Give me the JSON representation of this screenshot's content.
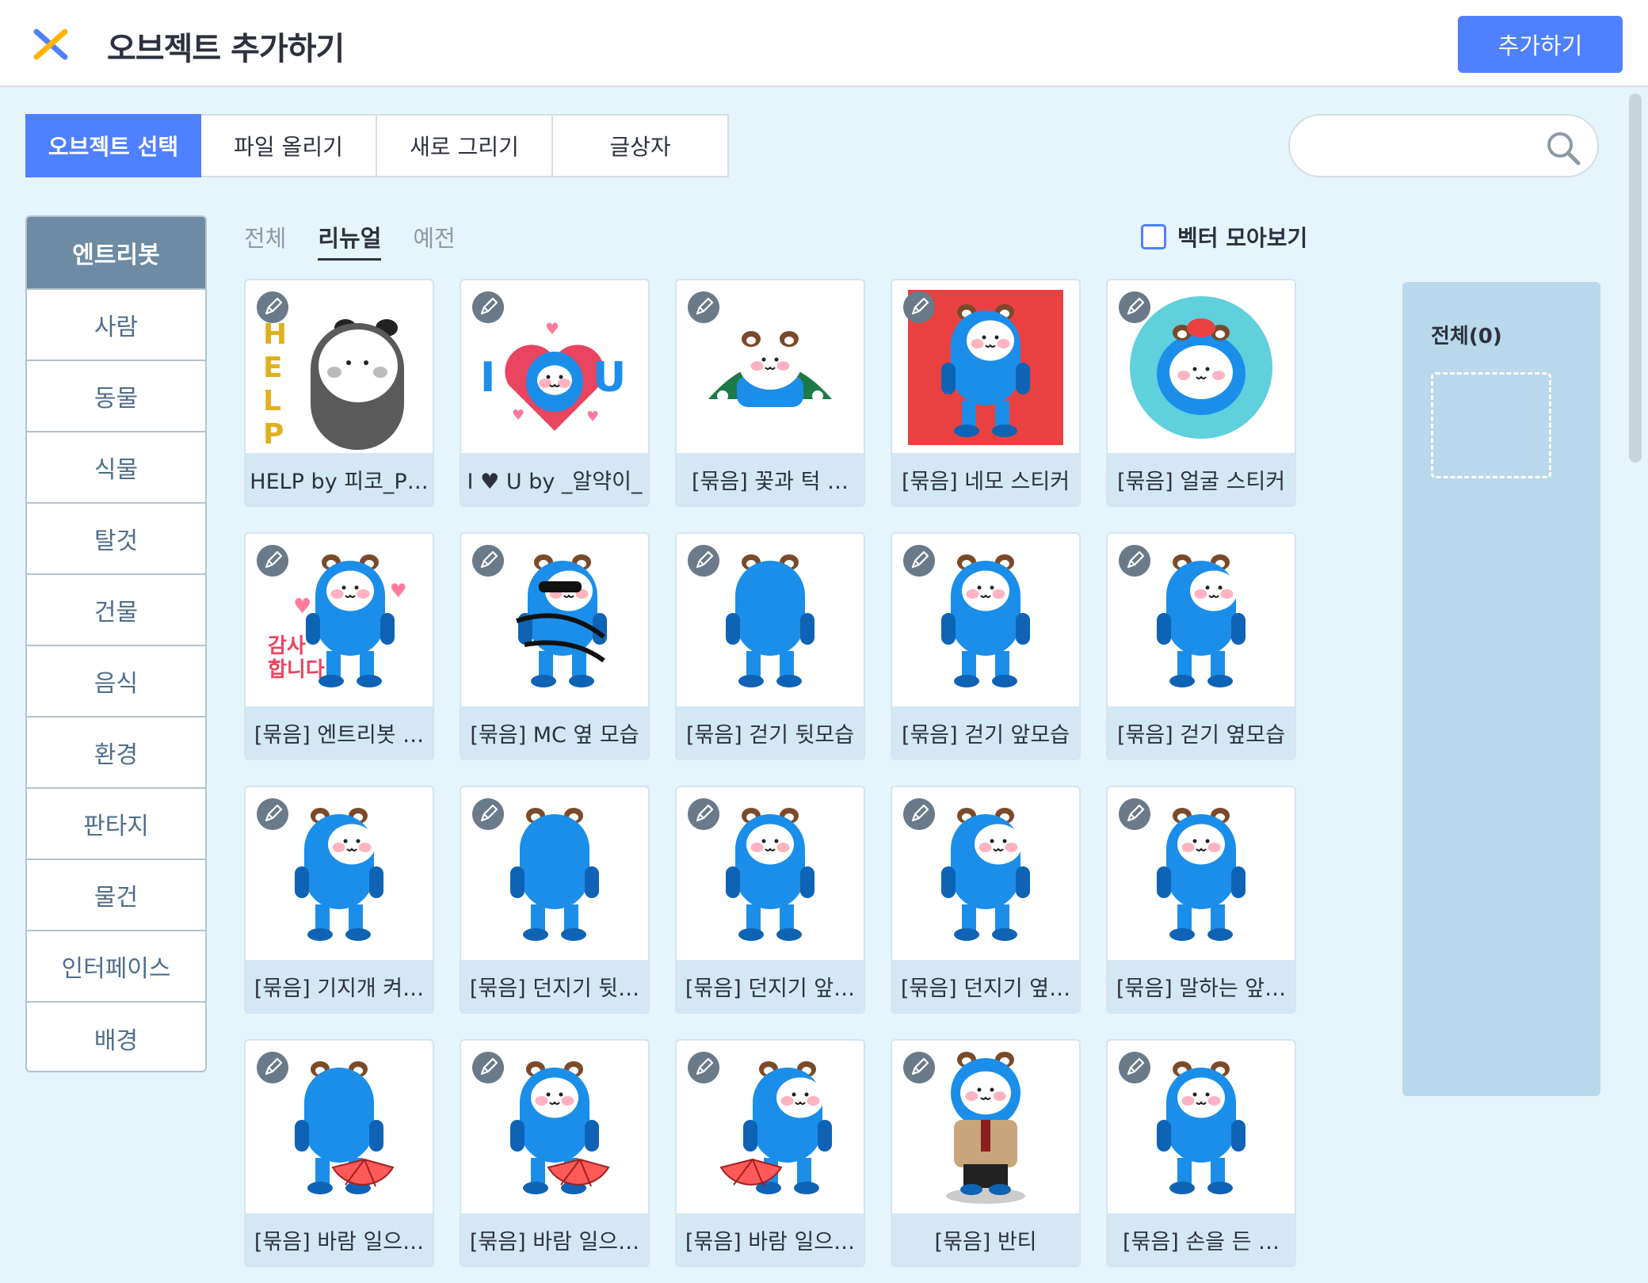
{
  "header": {
    "title": "오브젝트 추가하기",
    "add_button": "추가하기",
    "close_icon": "close-x-icon",
    "close_colors": [
      "#4f80ff",
      "#ffb500"
    ]
  },
  "tabs": [
    {
      "label": "오브젝트 선택",
      "active": true
    },
    {
      "label": "파일 올리기",
      "active": false
    },
    {
      "label": "새로 그리기",
      "active": false
    },
    {
      "label": "글상자",
      "active": false
    }
  ],
  "search": {
    "value": "",
    "placeholder": "",
    "icon": "search-icon"
  },
  "categories": [
    {
      "label": "엔트리봇",
      "active": true
    },
    {
      "label": "사람"
    },
    {
      "label": "동물"
    },
    {
      "label": "식물"
    },
    {
      "label": "탈것"
    },
    {
      "label": "건물"
    },
    {
      "label": "음식"
    },
    {
      "label": "환경"
    },
    {
      "label": "판타지"
    },
    {
      "label": "물건"
    },
    {
      "label": "인터페이스"
    },
    {
      "label": "배경"
    }
  ],
  "subtabs": [
    {
      "label": "전체"
    },
    {
      "label": "리뉴얼",
      "active": true
    },
    {
      "label": "예전"
    }
  ],
  "vector_toggle": {
    "label": "벡터 모아보기",
    "checked": false
  },
  "objects": [
    {
      "label": "HELP by 피코_P…",
      "art": "help"
    },
    {
      "label": "I ♥ U by _알약이_",
      "art": "iloveu"
    },
    {
      "label": "[묶음] 꽃과 턱 …",
      "art": "flower"
    },
    {
      "label": "[묶음] 네모 스티커",
      "art": "square"
    },
    {
      "label": "[묶음] 얼굴 스티커",
      "art": "circle"
    },
    {
      "label": "[묶음] 엔트리봇 …",
      "art": "hug"
    },
    {
      "label": "[묶음] MC 옆 모습",
      "art": "mc"
    },
    {
      "label": "[묶음] 걷기 뒷모습",
      "art": "back"
    },
    {
      "label": "[묶음] 걷기 앞모습",
      "art": "front"
    },
    {
      "label": "[묶음] 걷기 옆모습",
      "art": "side"
    },
    {
      "label": "[묶음] 기지개 켜…",
      "art": "side"
    },
    {
      "label": "[묶음] 던지기 뒷…",
      "art": "back"
    },
    {
      "label": "[묶음] 던지기 앞…",
      "art": "front"
    },
    {
      "label": "[묶음] 던지기 옆…",
      "art": "side"
    },
    {
      "label": "[묶음] 말하는 앞…",
      "art": "front"
    },
    {
      "label": "[묶음] 바람 일으…",
      "art": "fanback"
    },
    {
      "label": "[묶음] 바람 일으…",
      "art": "fanfront"
    },
    {
      "label": "[묶음] 바람 일으…",
      "art": "fanside"
    },
    {
      "label": "[묶음] 반티",
      "art": "banti"
    },
    {
      "label": "[묶음] 손을 든 …",
      "art": "front"
    }
  ],
  "selected_panel": {
    "title": "전체(0)"
  },
  "colors": {
    "accent": "#4f80ff",
    "bot_blue": "#1b8eea",
    "category_active": "#6d8ba3"
  }
}
